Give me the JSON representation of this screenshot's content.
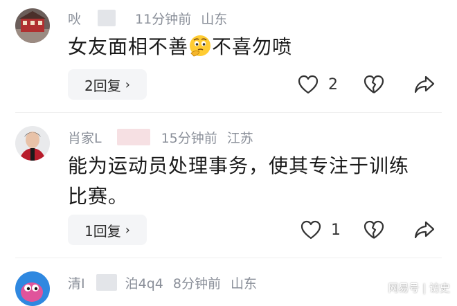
{
  "comments": [
    {
      "username": "吙",
      "time": "11分钟前",
      "location": "山东",
      "text_before": "女友面相不善",
      "emoji": "thinking-face-emoji",
      "text_after": "不喜勿喷",
      "reply_label": "2回复",
      "like_count": "2"
    },
    {
      "username": "肖家L",
      "time": "15分钟前",
      "location": "江苏",
      "text_line1": "能为运动员处理事务，使其专注于训练",
      "text_line2": "比赛。",
      "reply_label": "1回复",
      "like_count": "1"
    },
    {
      "username_a": "清I",
      "username_b": "泊4q4",
      "time": "8分钟前",
      "location": "山东"
    }
  ],
  "icons": {
    "like": "heart-icon",
    "dislike": "broken-heart-icon",
    "share": "share-arrow-icon",
    "reply_chevron": "chevron-right-icon"
  },
  "watermark": "网易号 | 访史",
  "colors": {
    "meta": "#8a8f99",
    "reply_bg": "#f4f5f7",
    "icon": "#333333"
  }
}
